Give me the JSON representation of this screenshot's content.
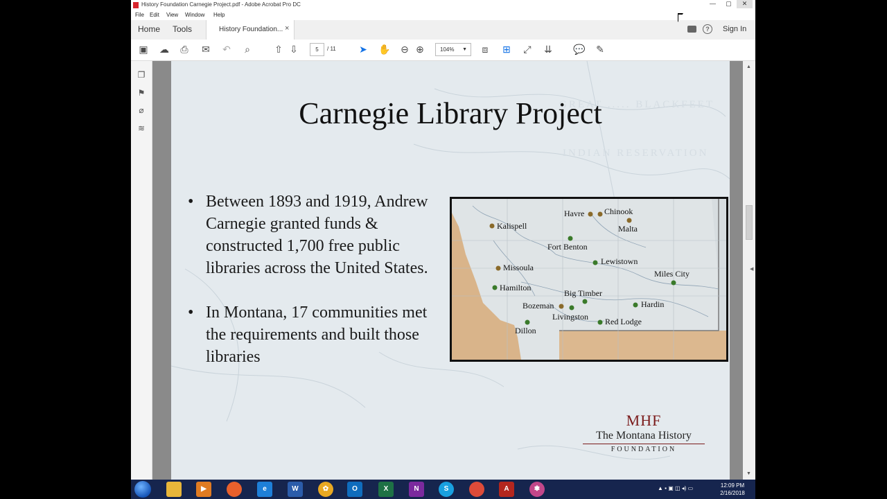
{
  "window": {
    "title": "History Foundation Carnegie Project.pdf - Adobe Acrobat Pro DC",
    "controls": {
      "minimize": "—",
      "maximize": "▢",
      "close": "✕"
    }
  },
  "menu": [
    "File",
    "Edit",
    "View",
    "Window",
    "Help"
  ],
  "tabs": {
    "home": "Home",
    "tools": "Tools",
    "document": "History Foundation...",
    "document_close": "×"
  },
  "account": {
    "sign_in": "Sign In"
  },
  "toolbar": {
    "current_page": "5",
    "total_pages": "/ 11",
    "zoom": "104%"
  },
  "slide": {
    "title": "Carnegie Library Project",
    "bullets": [
      "Between 1893 and 1919, Andrew Carnegie granted funds & constructed 1,700 free public libraries across the United States.",
      "In Montana, 17 communities met the requirements and built those libraries"
    ],
    "bullet_marker": "•",
    "map_labels": {
      "havre": "Havre",
      "chinook": "Chinook",
      "kalispell": "Kalispell",
      "malta": "Malta",
      "fort_benton": "Fort Benton",
      "lewistown": "Lewistown",
      "missoula": "Missoula",
      "miles_city": "Miles City",
      "hamilton": "Hamilton",
      "big_timber": "Big Timber",
      "bozeman": "Bozeman",
      "hardin": "Hardin",
      "livingston": "Livingston",
      "dillon": "Dillon",
      "red_lodge": "Red Lodge"
    },
    "logo": {
      "mark": "MHF",
      "org_name": "The Montana History",
      "foundation": "FOUNDATION"
    }
  },
  "taskbar": {
    "clock_time": "12:09 PM",
    "clock_date": "2/16/2018"
  },
  "colors": {
    "accent": "#1473e6",
    "slide_bg": "#e4eaee",
    "logo_red": "#7a1a1a",
    "taskbar": "#16254e"
  }
}
